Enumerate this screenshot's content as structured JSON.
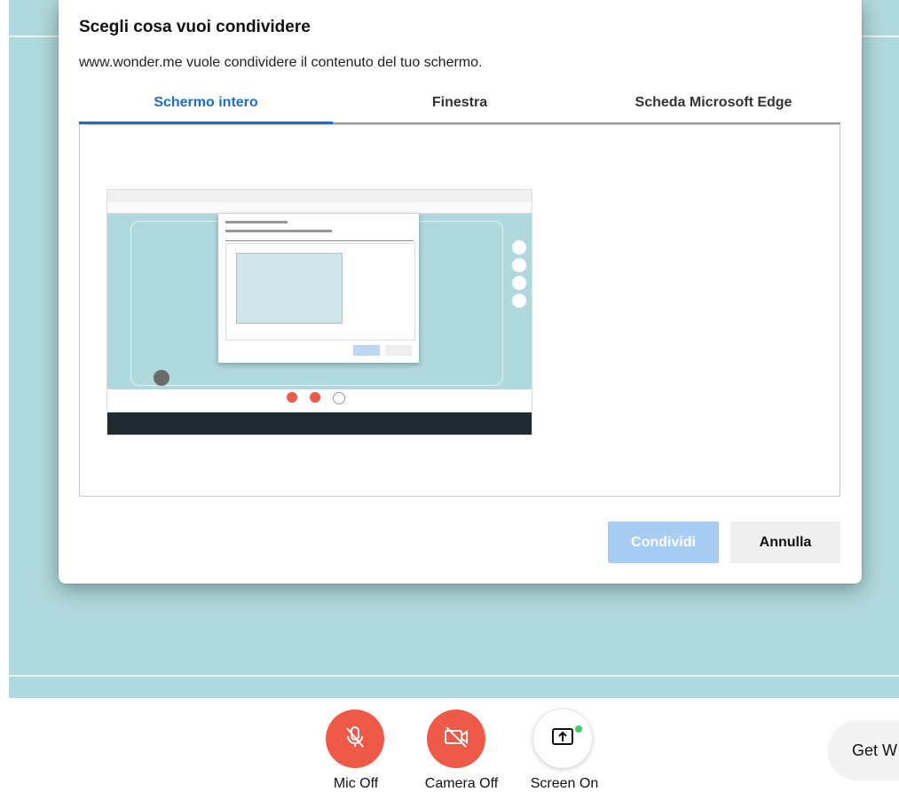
{
  "dialog": {
    "title": "Scegli cosa vuoi condividere",
    "subtitle": "www.wonder.me vuole condividere il contenuto del tuo schermo.",
    "tabs": [
      {
        "label": "Schermo intero",
        "active": true
      },
      {
        "label": "Finestra",
        "active": false
      },
      {
        "label": "Scheda Microsoft Edge",
        "active": false
      }
    ],
    "share_label": "Condividi",
    "cancel_label": "Annulla"
  },
  "controls": {
    "mic_label": "Mic Off",
    "camera_label": "Camera Off",
    "screen_label": "Screen On",
    "get_label": "Get W"
  },
  "colors": {
    "accent": "#1a6fc4",
    "canvas": "#b0d9dd",
    "control_red": "#ee5948",
    "share_disabled": "#a9cdf2",
    "status_green": "#3ccf6e"
  },
  "icons": [
    "mic-off-icon",
    "camera-off-icon",
    "screen-share-icon"
  ]
}
